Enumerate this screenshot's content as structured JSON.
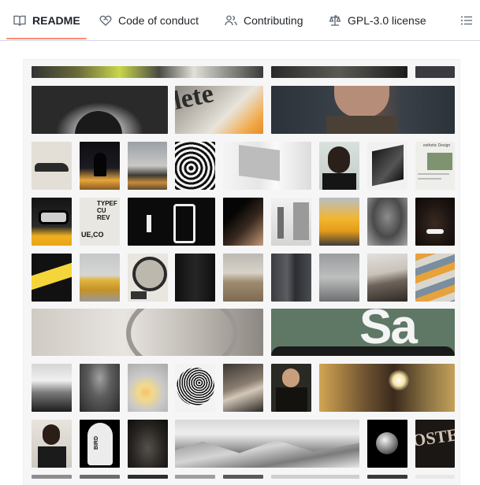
{
  "tabs": [
    {
      "label": "README",
      "icon": "book-icon",
      "active": true
    },
    {
      "label": "Code of conduct",
      "icon": "heart-hands-icon",
      "active": false
    },
    {
      "label": "Contributing",
      "icon": "people-icon",
      "active": false
    },
    {
      "label": "GPL-3.0 license",
      "icon": "law-scale-icon",
      "active": false
    }
  ],
  "toc_icon": "list-unordered-icon",
  "gallery": {
    "tile_texts": {
      "lettering_large_wide": "Sa",
      "lettering_tile_typeface": "TYPEF\nCU\nREV",
      "lettering_tile_ue": "UE,CO",
      "lettering_tile_bird": "BIRD",
      "lettering_tile_poster": "OSTE",
      "lettering_tile_lete": "lete",
      "lettering_tile_aesthetic": "esthetic Design"
    }
  }
}
